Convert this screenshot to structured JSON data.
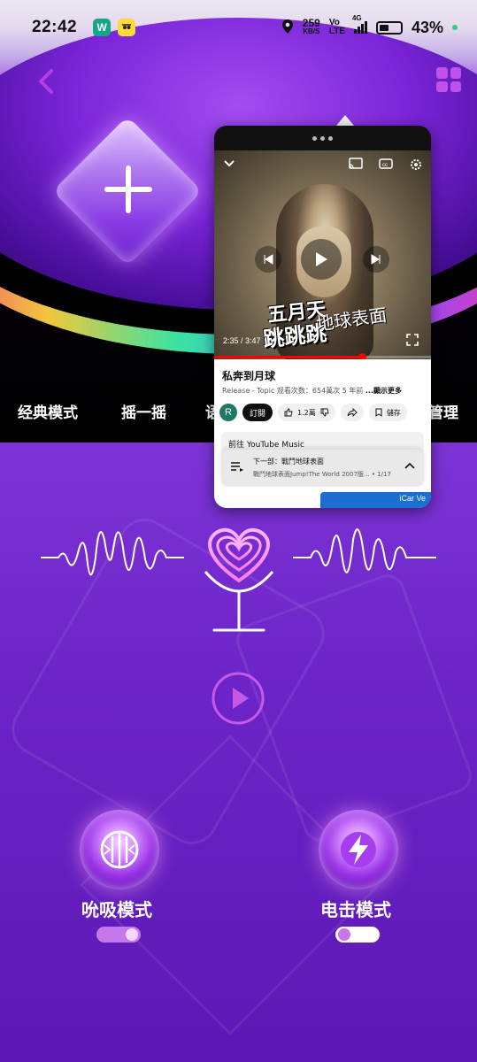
{
  "status_bar": {
    "time": "22:42",
    "app_icon_1": "W",
    "speed_value": "259",
    "speed_unit": "KB/S",
    "volte_1": "Vo",
    "volte_2": "LTE",
    "network": "4G",
    "battery_percent": "43%",
    "icons": [
      "location-icon",
      "signal-icon",
      "battery-icon"
    ]
  },
  "header": {
    "back_icon": "chevron-left-icon",
    "menu_icon": "grid-icon",
    "add_icon": "plus-icon"
  },
  "tabs": [
    "经典模式",
    "摇一摇",
    "语",
    "管理"
  ],
  "pip_player": {
    "video": {
      "art_title": "五月天",
      "art_subtitle": "跳跳跳",
      "art_line": "地球表面",
      "time": "2:35 / 3:47",
      "progress": 0.68
    },
    "title": "私奔到月球",
    "meta": "Release - Topic  观看次数：654萬次  5 年前  ",
    "meta_more": "...顯示更多",
    "channel_initial": "R",
    "subscribe_label": "訂閱",
    "like_count": "1.2萬",
    "save_label": "儲存",
    "youtube_music_label": "前往 YouTube Music",
    "up_next_title": "下一部：戰鬥地球表面",
    "up_next_sub": "戰鬥地球表面Jump!The World 2007版...",
    "up_next_count": "• 1/17",
    "ad_text": "iCar Ve"
  },
  "modes": {
    "left_label": "吮吸模式",
    "right_label": "电击模式",
    "left_on": true,
    "right_on": false,
    "left_icon": "breath-icon",
    "right_icon": "lightning-icon"
  },
  "colors": {
    "accent": "#c050e8",
    "background": "#6a22c4",
    "youtube_red": "#ff0000"
  }
}
